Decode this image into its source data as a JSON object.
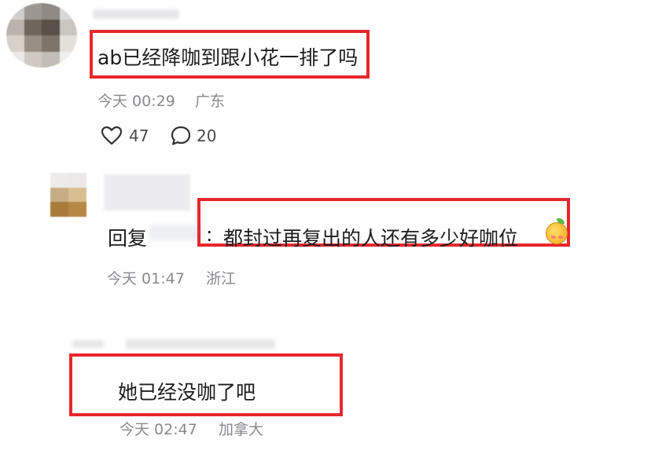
{
  "comments": [
    {
      "text": "ab已经降咖到跟小花一排了吗",
      "time": "今天 00:29",
      "location": "广东",
      "likes": "47",
      "replies": "20"
    },
    {
      "reply_prefix": "回复",
      "separator": ":",
      "text": "都封过再复出的人还有多少好咖位",
      "time": "今天 01:47",
      "location": "浙江"
    },
    {
      "text": "她已经没咖了吧",
      "time": "今天 02:47",
      "location": "加拿大"
    }
  ],
  "icons": {
    "like": "heart-icon",
    "comment": "comment-bubble-icon",
    "emoji": "orange-face-emoji"
  },
  "colors": {
    "highlight": "#e8272b",
    "meta_text": "#8a8a8e"
  }
}
